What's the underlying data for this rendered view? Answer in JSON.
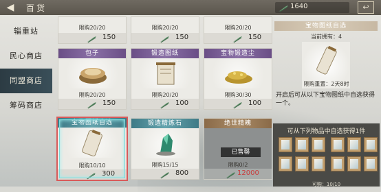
{
  "header": {
    "title": "百货",
    "currency_value": "1640",
    "back_icon": "back-arrow-icon",
    "close_icon": "close-icon"
  },
  "sidebar": {
    "items": [
      {
        "label": "辎重站",
        "active": false
      },
      {
        "label": "民心商店",
        "active": false
      },
      {
        "label": "同盟商店",
        "active": true
      },
      {
        "label": "筹码商店",
        "active": false
      }
    ]
  },
  "shop": {
    "top_row": [
      {
        "limit": "限购20/20",
        "price": "150"
      },
      {
        "limit": "限购20/20",
        "price": "150"
      },
      {
        "limit": "限购20/20",
        "price": "150"
      }
    ],
    "mid_row": [
      {
        "name": "包子",
        "limit": "限购20/20",
        "price": "150",
        "color": "purple"
      },
      {
        "name": "锻造图纸",
        "limit": "限购20/20",
        "price": "100",
        "color": "purple"
      },
      {
        "name": "宝物锻造尘",
        "limit": "限购30/30",
        "price": "100",
        "color": "purple"
      }
    ],
    "bottom_row": [
      {
        "name": "宝物图纸自选",
        "limit": "限购10/10",
        "price": "300",
        "color": "teal"
      },
      {
        "name": "锻造精炼石",
        "limit": "限购15/15",
        "price": "800",
        "color": "teal"
      },
      {
        "name": "绝世精魄",
        "limit": "限购0/2",
        "price": "12000",
        "color": "amber",
        "soldout_label": "已售罄"
      }
    ]
  },
  "detail": {
    "title": "宝物图纸自选",
    "owned": "当前拥有：4",
    "reset": "限购重置：2天8时",
    "description": "开启后可从以下宝物图纸中自选获得一个。",
    "pool_title": "可从下列物品中自选获得1件",
    "pool_bottom": "可购：10/10"
  },
  "colors": {
    "selected_border": "#d85a5a",
    "price_red": "#c83c3c"
  }
}
